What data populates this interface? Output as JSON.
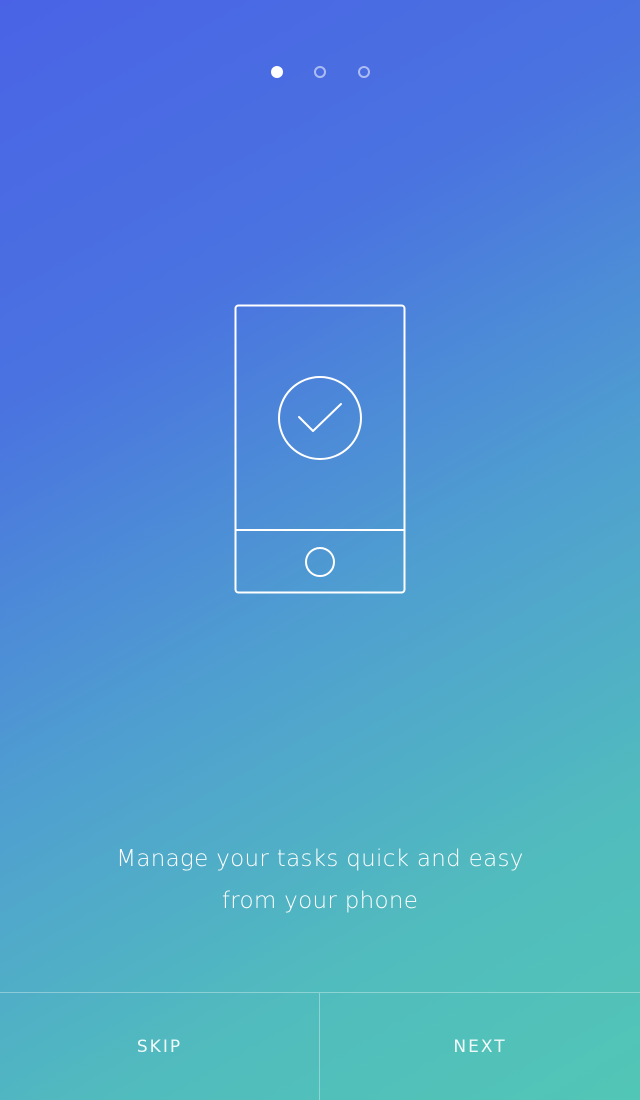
{
  "pager": {
    "total_pages": 3,
    "current_page": 1
  },
  "illustration": {
    "icon": "phone-checkmark-icon"
  },
  "caption": {
    "line1": "Manage your tasks quick and easy",
    "line2": "from your phone"
  },
  "buttons": {
    "skip_label": "SKIP",
    "next_label": "NEXT"
  },
  "colors": {
    "gradient_start": "#4a63e6",
    "gradient_end": "#52c6b6",
    "foreground": "#ffffff"
  }
}
